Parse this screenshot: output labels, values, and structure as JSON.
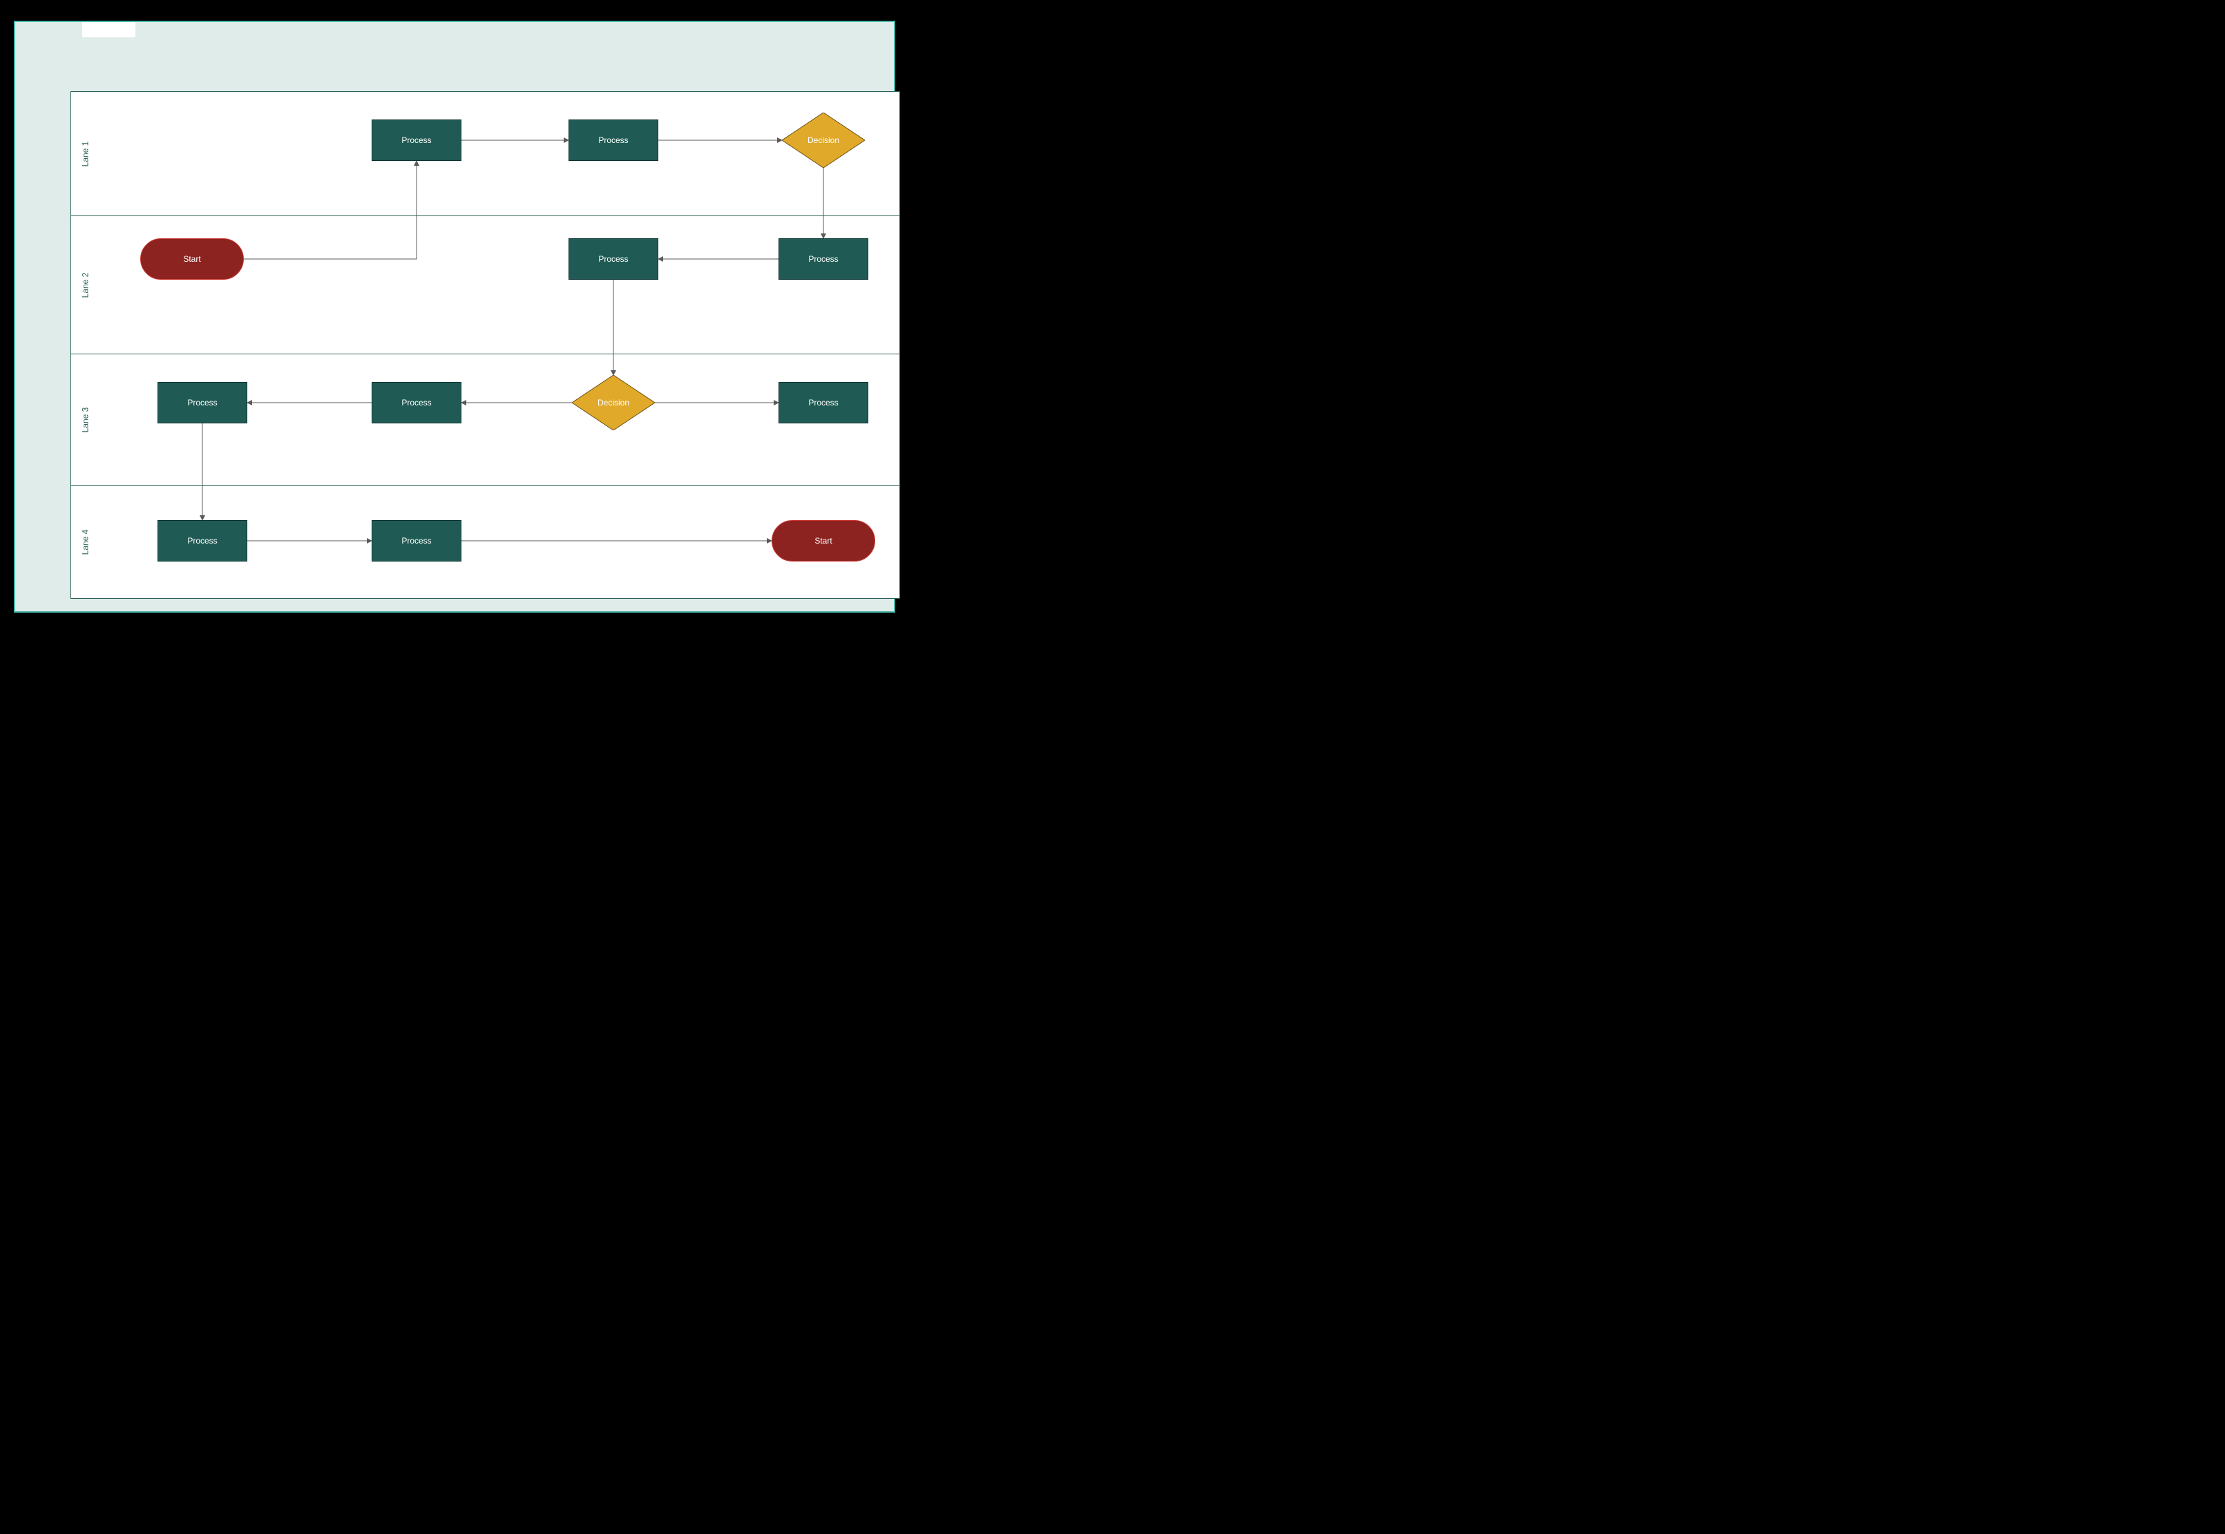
{
  "diagram": {
    "lanes": [
      {
        "label": "Lane 1"
      },
      {
        "label": "Lane 2"
      },
      {
        "label": "Lane 3"
      },
      {
        "label": "Lane 4"
      }
    ],
    "nodes": {
      "start1": {
        "label": "Start",
        "type": "terminator"
      },
      "process1": {
        "label": "Process",
        "type": "process"
      },
      "process2": {
        "label": "Process",
        "type": "process"
      },
      "decision1": {
        "label": "Decision",
        "type": "decision"
      },
      "process3": {
        "label": "Process",
        "type": "process"
      },
      "process4": {
        "label": "Process",
        "type": "process"
      },
      "decision2": {
        "label": "Decision",
        "type": "decision"
      },
      "process5": {
        "label": "Process",
        "type": "process"
      },
      "process6": {
        "label": "Process",
        "type": "process"
      },
      "process7": {
        "label": "Process",
        "type": "process"
      },
      "process8": {
        "label": "Process",
        "type": "process"
      },
      "process9": {
        "label": "Process",
        "type": "process"
      },
      "start2": {
        "label": "Start",
        "type": "terminator"
      }
    },
    "edges": [
      [
        "start1",
        "process1"
      ],
      [
        "process1",
        "process2"
      ],
      [
        "process2",
        "decision1"
      ],
      [
        "decision1",
        "process3"
      ],
      [
        "process3",
        "process4"
      ],
      [
        "process4",
        "decision2"
      ],
      [
        "decision2",
        "process5"
      ],
      [
        "process5",
        "process6"
      ],
      [
        "process6",
        "process8"
      ],
      [
        "process8",
        "process9"
      ],
      [
        "process9",
        "start2"
      ],
      [
        "decision2",
        "process7"
      ]
    ]
  }
}
